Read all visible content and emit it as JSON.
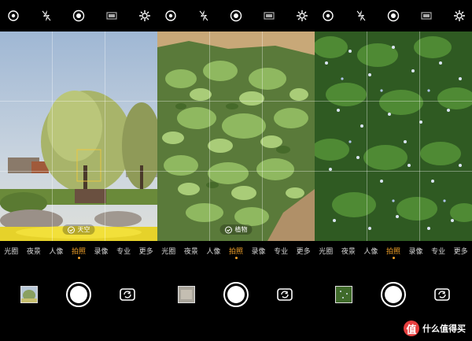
{
  "screens": [
    {
      "modes": [
        "光圈",
        "夜景",
        "人像",
        "拍照",
        "录像",
        "专业",
        "更多"
      ],
      "active_mode": "拍照",
      "ai_badge": "天空",
      "scene": "willow-park"
    },
    {
      "modes": [
        "光圈",
        "夜景",
        "人像",
        "拍照",
        "录像",
        "专业",
        "更多"
      ],
      "active_mode": "拍照",
      "ai_badge": "植物",
      "scene": "leafy-greens"
    },
    {
      "modes": [
        "光圈",
        "夜景",
        "人像",
        "拍照",
        "录像",
        "专业",
        "更多"
      ],
      "active_mode": "拍照",
      "ai_badge": "",
      "scene": "flower-ground-cover"
    }
  ],
  "icons": {
    "top": [
      "hdr-icon",
      "flash-off-icon",
      "ai-scene-icon",
      "aspect-ratio-icon",
      "settings-gear-icon"
    ],
    "bottom": [
      "gallery-thumbnail",
      "shutter-button",
      "switch-camera-icon"
    ]
  },
  "colors": {
    "active_mode": "#f4a32a",
    "background": "#000000"
  },
  "watermark": {
    "logo_text": "值",
    "text": "什么值得买"
  }
}
